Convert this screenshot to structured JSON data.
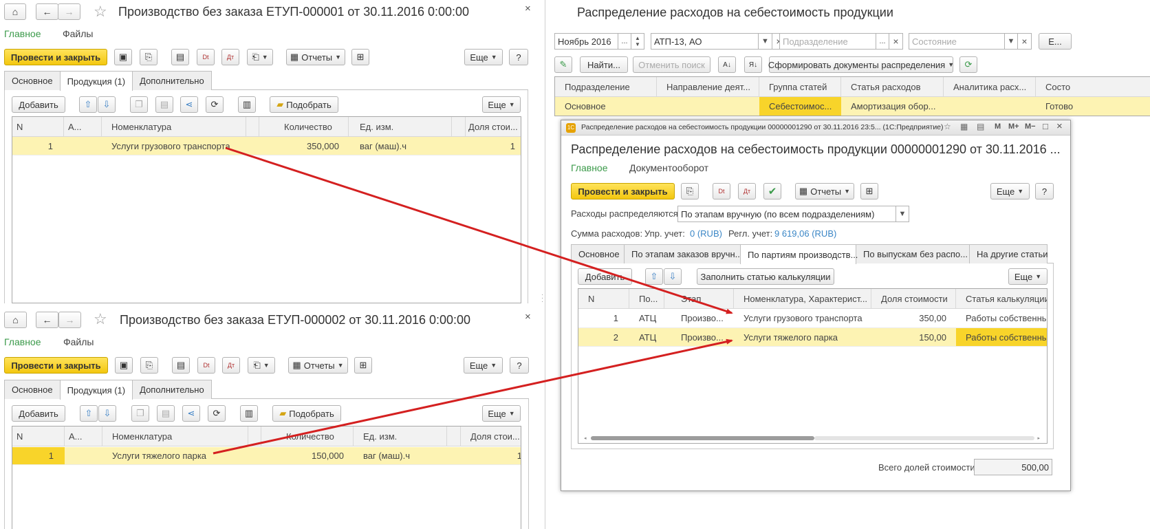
{
  "win1": {
    "title": "Производство без заказа ЕТУП-000001 от 30.11.2016 0:00:00",
    "nav_main": "Главное",
    "nav_files": "Файлы",
    "post_close": "Провести и закрыть",
    "reports": "Отчеты",
    "more": "Еще",
    "help": "?",
    "tabs": [
      "Основное",
      "Продукция (1)",
      "Дополнительно"
    ],
    "add": "Добавить",
    "pick": "Подобрать",
    "more2": "Еще",
    "columns": [
      "N",
      "А...",
      "Номенклатура",
      "Количество",
      "Ед. изм.",
      "Доля стои..."
    ],
    "row": {
      "n": "1",
      "nom": "Услуги грузового транспорта",
      "qty": "350,000",
      "unit": "ваг (маш).ч",
      "share": "1"
    }
  },
  "win2": {
    "title": "Производство без заказа ЕТУП-000002 от 30.11.2016 0:00:00",
    "nav_main": "Главное",
    "nav_files": "Файлы",
    "post_close": "Провести и закрыть",
    "reports": "Отчеты",
    "more": "Еще",
    "help": "?",
    "tabs": [
      "Основное",
      "Продукция (1)",
      "Дополнительно"
    ],
    "add": "Добавить",
    "pick": "Подобрать",
    "more2": "Еще",
    "columns": [
      "N",
      "А...",
      "Номенклатура",
      "Количество",
      "Ед. изм.",
      "Доля стои..."
    ],
    "row": {
      "n": "1",
      "nom": "Услуги тяжелого парка",
      "qty": "150,000",
      "unit": "ваг (маш).ч",
      "share": "1"
    }
  },
  "list": {
    "title": "Распределение расходов на себестоимость продукции",
    "period": "Ноябрь 2016",
    "org": "АТП-13, АО",
    "dept_ph": "Подразделение",
    "state_ph": "Состояние",
    "more_short": "Е...",
    "find": "Найти...",
    "cancel_search": "Отменить поиск",
    "form_docs": "Сформировать документы распределения",
    "columns": [
      "Подразделение",
      "Направление деят...",
      "Группа статей",
      "Статья расходов",
      "Аналитика расх...",
      "Состо"
    ],
    "row": {
      "dept": "Основное",
      "dir": "",
      "group": "Себестоимос...",
      "item": "Амортизация обор...",
      "analytics": "",
      "state": "Готово"
    }
  },
  "doc": {
    "window_caption": "Распределение расходов на себестоимость продукции 00000001290 от 30.11.2016 23:5... (1С:Предприятие)",
    "title": "Распределение расходов на себестоимость продукции 00000001290 от 30.11.2016 ...",
    "nav_main": "Главное",
    "nav_docflow": "Документооборот",
    "post_close": "Провести и закрыть",
    "reports": "Отчеты",
    "more": "Еще",
    "help": "?",
    "distrib_label": "Расходы распределяются:",
    "distrib_value": "По этапам вручную (по всем подразделениям)",
    "sum_label": "Сумма расходов:",
    "mgmt_label": "Упр. учет:",
    "mgmt_value": "0 (RUB)",
    "reg_label": "Регл. учет:",
    "reg_value": "9 619,06 (RUB)",
    "tabs": [
      "Основное",
      "По этапам заказов вручн...",
      "По партиям производств...",
      "По выпускам без распо...",
      "На другие статьи"
    ],
    "add": "Добавить",
    "fill": "Заполнить статью калькуляции",
    "more2": "Еще",
    "columns": [
      "N",
      "По...",
      "Этап",
      "Номенклатура, Характерист...",
      "Доля стоимости",
      "Статья калькуляции"
    ],
    "rows": [
      {
        "n": "1",
        "po": "АТЦ",
        "stage": "Произво...",
        "nom": "Услуги грузового транспорта",
        "share": "350,00",
        "calc": "Работы собственным"
      },
      {
        "n": "2",
        "po": "АТЦ",
        "stage": "Произво...",
        "nom": "Услуги тяжелого парка",
        "share": "150,00",
        "calc": "Работы собственным"
      }
    ],
    "total_label": "Всего долей стоимости:",
    "total_value": "500,00"
  },
  "colors": {
    "accent_yellow": "#f3c710",
    "green_link": "#3b9a4a",
    "arrow_red": "#d42020"
  }
}
